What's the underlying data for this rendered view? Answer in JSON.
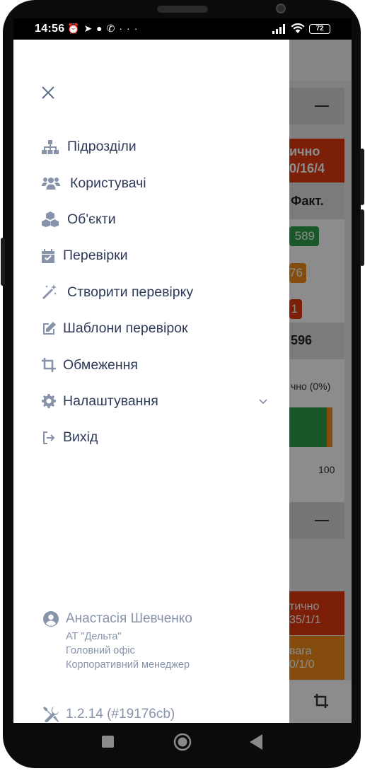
{
  "status_bar": {
    "time": "14:56",
    "battery": "72",
    "icons": [
      "alarm-icon",
      "telegram-icon",
      "chat-icon",
      "viber-icon",
      "more-icon",
      "signal-icon",
      "wifi-icon",
      "battery-icon"
    ]
  },
  "drawer": {
    "menu": [
      {
        "label": "Підрозділи",
        "icon": "sitemap-icon"
      },
      {
        "label": "Користувачі",
        "icon": "users-icon"
      },
      {
        "label": "Об'єкти",
        "icon": "cubes-icon"
      },
      {
        "label": "Перевірки",
        "icon": "calendar-check-icon"
      },
      {
        "label": "Створити перевірку",
        "icon": "magic-wand-icon"
      },
      {
        "label": "Шаблони перевірок",
        "icon": "edit-icon"
      },
      {
        "label": "Обмеження",
        "icon": "crop-icon"
      },
      {
        "label": "Налаштування",
        "icon": "gear-icon"
      },
      {
        "label": "Вихід",
        "icon": "sign-out-icon"
      }
    ],
    "profile": {
      "name": "Анастасія Шевченко",
      "company": "АТ \"Дельта\"",
      "office": "Головний офіс",
      "role": "Корпоративний менеджер"
    },
    "version": "1.2.14 (#19176cb)"
  },
  "background": {
    "red_header_line1": "ично",
    "red_header_line2": "0/16/4",
    "fact_header": "Факт.",
    "green_badge": "589",
    "orange_badge": "76",
    "red_badge": "1",
    "total": "596",
    "partial_label": "чно (0%)",
    "axis_max": "100",
    "card2_red_line1": "тично",
    "card2_red_line2": "35/1/1",
    "card2_orange_line1": "вага",
    "card2_orange_line2": "0/1/0",
    "colors": {
      "red": "#e03a12",
      "green": "#2e9e4a",
      "orange": "#f08c1a"
    }
  }
}
